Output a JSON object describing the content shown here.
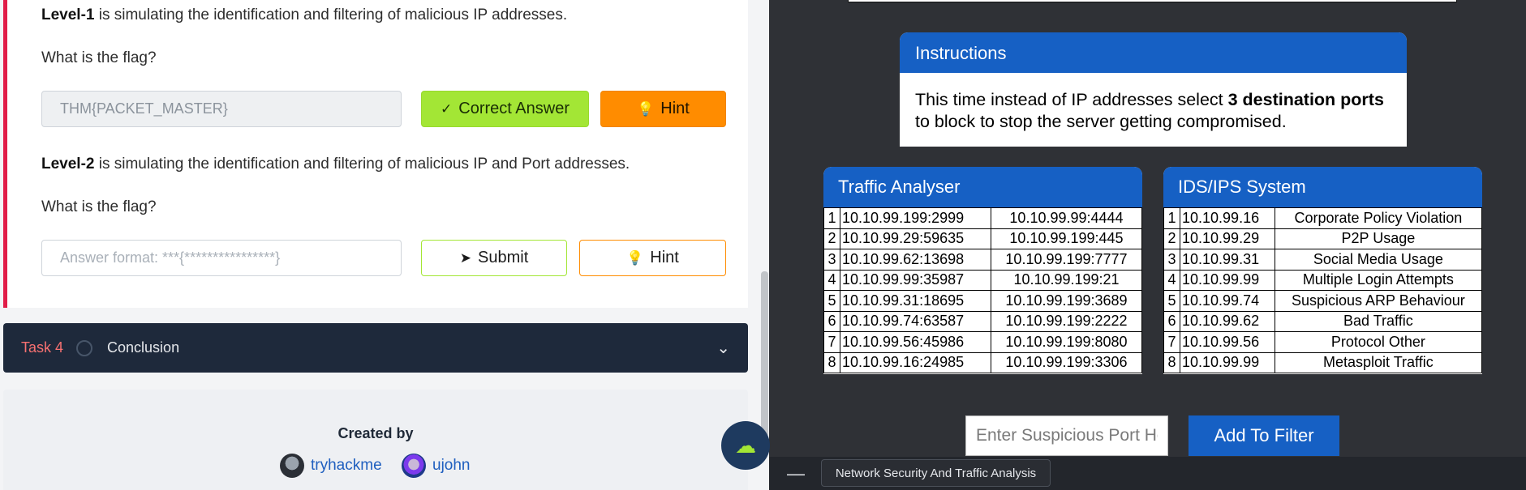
{
  "task3": {
    "level1_prefix": "Level-1",
    "level1_text": " is simulating the identification and filtering of malicious IP addresses.",
    "question1": "What is the flag?",
    "answer1_value": "THM{PACKET_MASTER}",
    "correct_label": "Correct Answer",
    "hint_label": "Hint",
    "level2_prefix": "Level-2",
    "level2_text": " is simulating the identification and filtering of malicious IP and Port addresses.",
    "question2": "What is the flag?",
    "answer2_placeholder": "Answer format: ***{****************}",
    "submit_label": "Submit"
  },
  "task4": {
    "label": "Task 4",
    "title": "Conclusion"
  },
  "created": {
    "title": "Created by",
    "authors": [
      "tryhackme",
      "ujohn"
    ]
  },
  "instructions": {
    "title": "Instructions",
    "text_before": "This time instead of IP addresses select ",
    "text_bold": "3 destination ports",
    "text_after": " to block to stop the server getting compromised."
  },
  "traffic_analyser": {
    "title": "Traffic Analyser",
    "rows": [
      [
        "1",
        "10.10.99.199:2999",
        "10.10.99.99:4444"
      ],
      [
        "2",
        "10.10.99.29:59635",
        "10.10.99.199:445"
      ],
      [
        "3",
        "10.10.99.62:13698",
        "10.10.99.199:7777"
      ],
      [
        "4",
        "10.10.99.99:35987",
        "10.10.99.199:21"
      ],
      [
        "5",
        "10.10.99.31:18695",
        "10.10.99.199:3689"
      ],
      [
        "6",
        "10.10.99.74:63587",
        "10.10.99.199:2222"
      ],
      [
        "7",
        "10.10.99.56:45986",
        "10.10.99.199:8080"
      ],
      [
        "8",
        "10.10.99.16:24985",
        "10.10.99.199:3306"
      ]
    ]
  },
  "ids_ips": {
    "title": "IDS/IPS System",
    "rows": [
      [
        "1",
        "10.10.99.16",
        "Corporate Policy Violation"
      ],
      [
        "2",
        "10.10.99.29",
        "P2P Usage"
      ],
      [
        "3",
        "10.10.99.31",
        "Social Media Usage"
      ],
      [
        "4",
        "10.10.99.99",
        "Multiple Login Attempts"
      ],
      [
        "5",
        "10.10.99.74",
        "Suspicious ARP Behaviour"
      ],
      [
        "6",
        "10.10.99.62",
        "Bad Traffic"
      ],
      [
        "7",
        "10.10.99.56",
        "Protocol Other"
      ],
      [
        "8",
        "10.10.99.99",
        "Metasploit Traffic"
      ]
    ]
  },
  "filter": {
    "placeholder": "Enter Suspicious Port Here",
    "button_label": "Add To Filter"
  },
  "bottom_bar": {
    "tab_label": "Network Security And Traffic Analysis"
  },
  "icons": {
    "check": "check-icon",
    "bulb": "lightbulb-icon",
    "send": "send-icon",
    "chevron": "chevron-down-icon",
    "minimize": "minimize-icon",
    "assistant": "cloud-assistant-icon"
  },
  "colors": {
    "accent_blue": "#1660c4",
    "correct_green": "#a3e635",
    "hint_orange": "#ff8c00",
    "task_red": "#e11d48",
    "dark_panel": "#2f3136"
  }
}
